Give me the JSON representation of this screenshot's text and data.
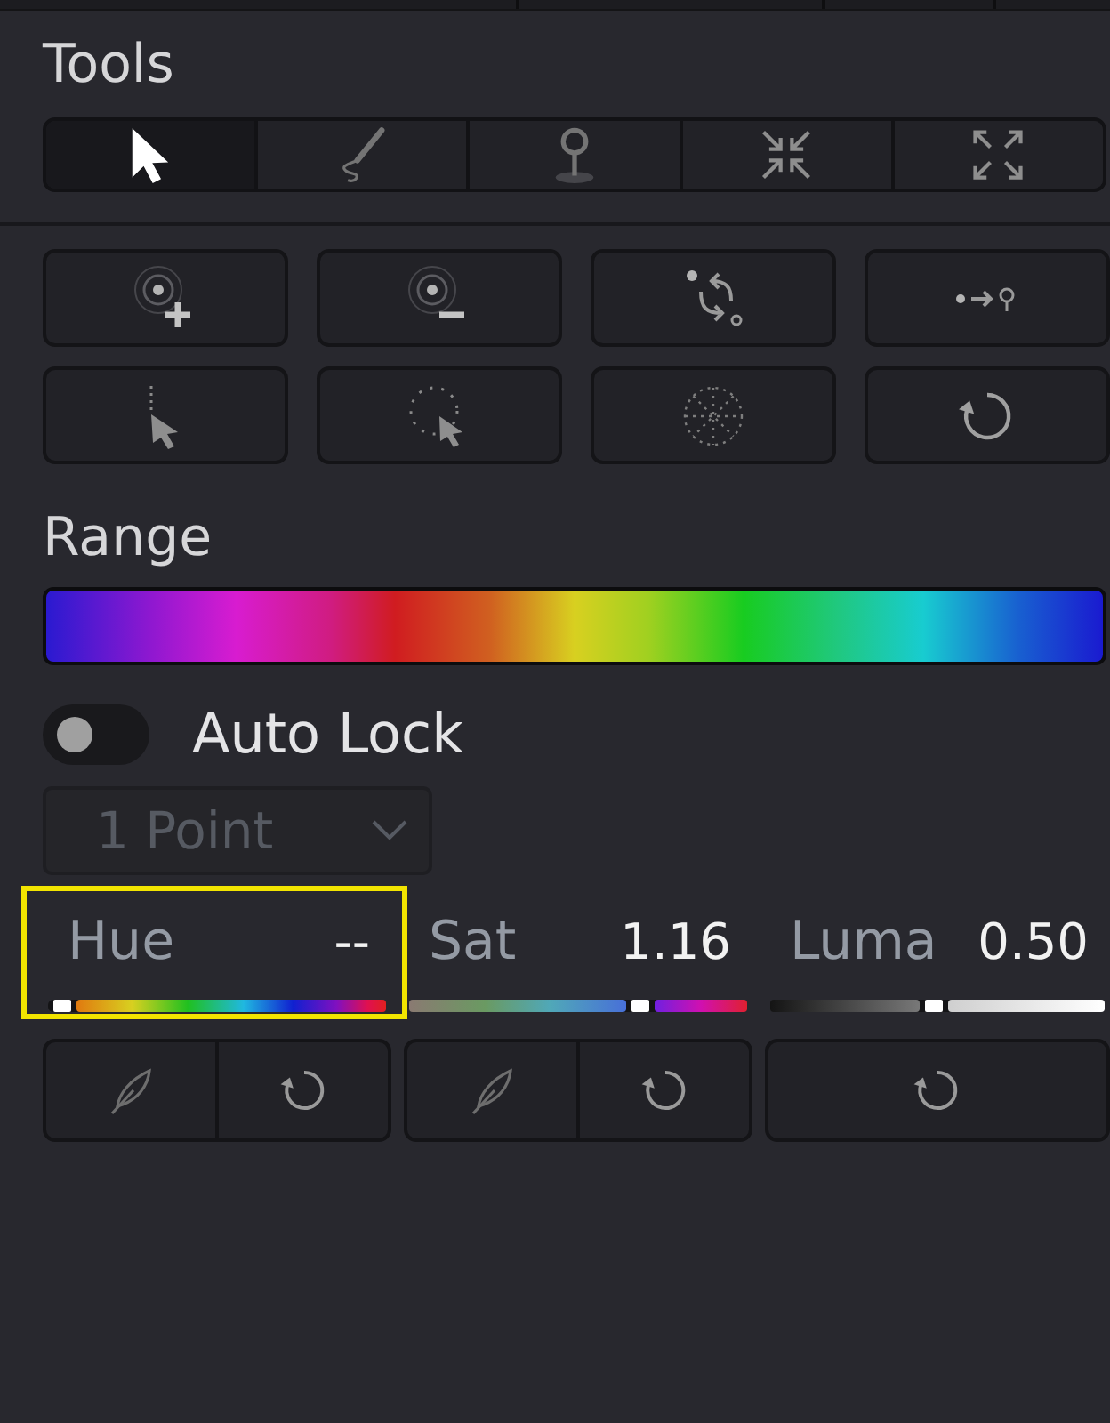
{
  "tools": {
    "title": "Tools",
    "modes": [
      {
        "selected": true
      },
      {
        "selected": false
      },
      {
        "selected": false
      },
      {
        "selected": false
      },
      {
        "selected": false
      }
    ]
  },
  "range": {
    "title": "Range"
  },
  "auto_lock": {
    "label": "Auto Lock",
    "on": false
  },
  "point_count": {
    "value": "1 Point",
    "disabled": true
  },
  "qualifiers": [
    {
      "kind": "hue",
      "label": "Hue",
      "value": "--",
      "level": 0,
      "highlighted": true
    },
    {
      "kind": "sat",
      "label": "Sat",
      "value": "1.16",
      "level": 0.7,
      "highlighted": false
    },
    {
      "kind": "luma",
      "label": "Luma",
      "value": "0.50",
      "level": 0.49,
      "highlighted": false
    }
  ]
}
